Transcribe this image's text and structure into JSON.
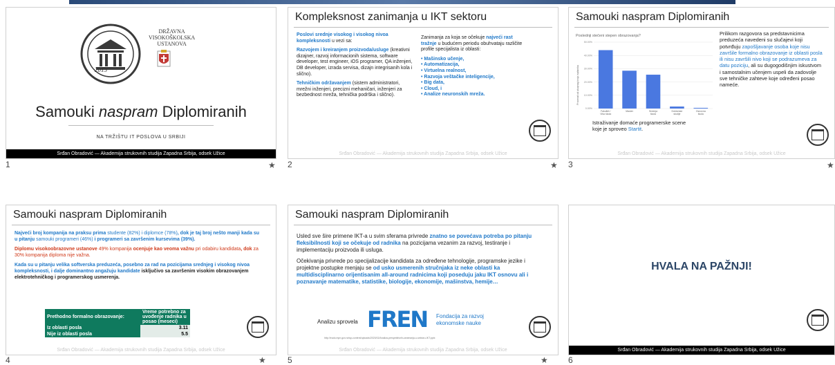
{
  "slides": [
    {
      "number": "1",
      "title_pre": "Samouki ",
      "title_em": "naspram",
      "title_post": " Diplomiranih",
      "subtitle": "NA TRŽIŠTU IT POSLOVA U SRBIJI",
      "institution": [
        "DRŽAVNA",
        "VISOKOŠKOLSKA",
        "USTANOVA"
      ],
      "seal_year": "2015",
      "footer": "Srđan Obradović — Akademija strukovnih studija Zapadna Srbija, odsek Užice"
    },
    {
      "number": "2",
      "title": "Kompleksnost zanimanja u IKT sektoru",
      "left": {
        "p1_blue": "Poslovi srednje visokog i visokog nivoa kompleksnosti",
        "p1_rest": " u vezi sa:",
        "p2_blue": "Razvojem i kreiranjem proizvoda/usluge",
        "p2_rest": " (kreativni dizajner, razvoj informacionih sistema, software developer, test engineer, iOS programer, QA inženjeri, DB developer, izrada servisa, dizajn integrisanih kola i slično).",
        "p3_blue": "Tehničkim održavanjem",
        "p3_rest": " (sistem administratori, mrežni inženjeri, precizni mehaničari, inženjeri za bezbednost mreža, tehnička podrška i slično)."
      },
      "right": {
        "intro_pre": "Zanimanja za koja se očekuje ",
        "intro_blue": "najveći rast tražnje",
        "intro_post": " u budućem periodu obuhvataju različite profile specijalista iz oblasti:",
        "items": [
          "• Mašinsko učenje,",
          "• Automatizacija,",
          "• Virtuelna realnost,",
          "• Razvoja veštačke inteligencije,",
          "• Big data,",
          "• Cloud, i",
          "• Analize neuronskih mreža."
        ]
      },
      "footer": "Srđan Obradović — Akademija strukovnih studija Zapadna Srbija, odsek Užice"
    },
    {
      "number": "3",
      "title": "Samouki naspram Diplomiranih",
      "text_pre": "Prilikom razgovora sa predstavnicima preduzeća navedeni su slučajevi koji potvrđuju ",
      "text_blue": "zapošljavanje osoba koje nisu završile formalno obrazovanje iz oblasti posla ili nisu završili nivo koji se podrazumeva za datu poziciju",
      "text_post": ", ali su dugogodišnjim iskustvom i samostalnim učenjem uspeli da zadovolje sve tehničke zahteve koje određeni posao nameće.",
      "source_pre": "Istraživanje domaće programerske scene koje je sproveo ",
      "source_link": "Startit",
      "source_post": ".",
      "footer": "Srđan Obradović — Akademija strukovnih studija Zapadna Srbija, odsek Užice"
    },
    {
      "number": "4",
      "title": "Samouki naspram Diplomiranih",
      "p1": [
        [
          "Najveći broj kompanija na praksu prima ",
          "blue b"
        ],
        [
          "studente (82%)",
          "blue"
        ],
        [
          " i diplomce (78%)",
          "blue"
        ],
        [
          ", dok je taj broj nešto manji kada su u pitanju ",
          "blue b"
        ],
        [
          "samouki programeri (46%)",
          "blue"
        ],
        [
          " i programeri sa završenim kursevima (39%).",
          "blue b"
        ]
      ],
      "p2": [
        [
          "Diplomu visokoobrazovne ustanove ",
          "red b"
        ],
        [
          "49% kompanija",
          "red"
        ],
        [
          " ocenjuje kao veoma važnu ",
          "red b"
        ],
        [
          "pri odabiru kandidata",
          "red"
        ],
        [
          ", dok ",
          "red b"
        ],
        [
          "za 30% kompanija diploma nije važna.",
          "red"
        ]
      ],
      "p3": [
        [
          "Kada su u pitanju velika softverska preduzeća, posebno za rad na pozicijama srednjeg i visokog nivoa kompleksnosti, i dalje dominantno angažuju kandidate ",
          "blue b"
        ],
        [
          "isključivo sa završenim visokim obrazovanjem elektrotehničkog i programerskog usmerenja.",
          "b"
        ]
      ],
      "table": {
        "h1": "Prethodno formalno obrazovanje:",
        "h2": "Vreme potrebno za uvođenje radnika u posao (meseci)",
        "rows": [
          [
            "Iz oblasti posla",
            "3.11"
          ],
          [
            "Nije iz oblasti posla",
            "5.5"
          ]
        ]
      },
      "footer": "Srđan Obradović — Akademija strukovnih studija Zapadna Srbija, odsek Užice"
    },
    {
      "number": "5",
      "title": "Samouki naspram Diplomiranih",
      "p1_pre": "Usled sve šire primene IKT-a u svim sferama privrede ",
      "p1_blue": "znatno se povećava potreba po pitanju fleksibilnosti koji se očekuje od radnika",
      "p1_post": " na pozicijama vezanim za razvoj, testiranje i implementaciju proizvoda ili usluga.",
      "p2_pre": "Očekivanja privrede po specijalizacije kandidata za određene tehnologije, programske jezike i projektne postupke menjaju se ",
      "p2_blue": "od usko usmerenih stručnjaka iz neke oblasti ka multidisciplinarno orijentisanim all-around radnicima koji poseduju jaku IKT osnovu ali i poznavanje matematike, statistike, biologije, ekonomije, mašinstva, hemije…",
      "credit": "Analizu sprovela",
      "logo_mark": "FREN",
      "logo_l1": "Fondacija za razvoj",
      "logo_l2": "ekonomske nauke",
      "url": "http://eudo.mpn.gov.rs/wp-content/uploads/2020/02/Analiza-perspektivnih-zanimanja-u-sektoru-IKT.pptx",
      "footer": "Srđan Obradović — Akademija strukovnih studija Zapadna Srbija, odsek Užice"
    },
    {
      "number": "6",
      "title": "HVALA NA PAŽNJI!",
      "footer": "Srđan Obradović — Akademija strukovnih studija Zapadna Srbija, odsek Užice"
    }
  ],
  "star": "★",
  "chart_data": {
    "type": "bar",
    "title": "Poslednji stečeni stepen obrazovanja?",
    "ylabel": "Procenat od ukupnog broja ispitanika",
    "categories": [
      "Fakultet / Viša škola",
      "Master",
      "Srednja škola",
      "Doktorske studije",
      "Osnovna škola"
    ],
    "values": [
      44.0,
      28.5,
      25.5,
      1.5,
      0.5
    ],
    "yticks": [
      "0.00%",
      "10.00%",
      "20.00%",
      "30.00%",
      "40.00%",
      "50.00%"
    ],
    "ylim": [
      0,
      50
    ],
    "color": "#4a78e0"
  }
}
